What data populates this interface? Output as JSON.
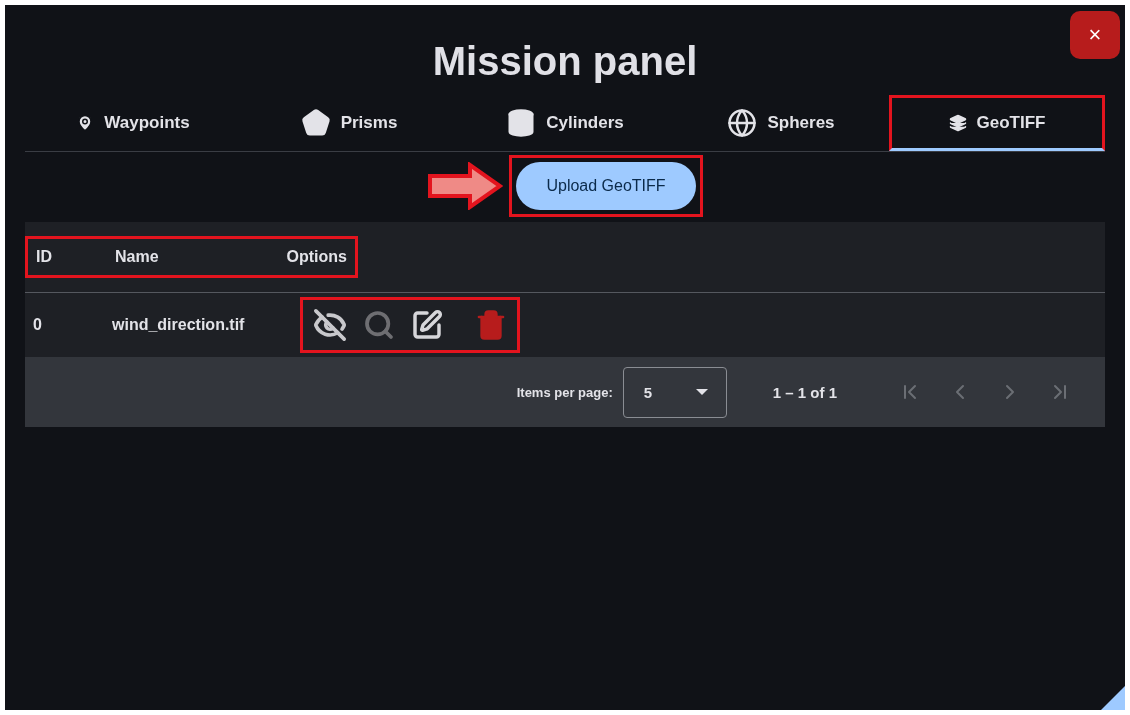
{
  "title": "Mission panel",
  "close_button": {
    "label": "×"
  },
  "tabs": [
    {
      "label": "Waypoints",
      "selected": false,
      "highlighted": false
    },
    {
      "label": "Prisms",
      "selected": false,
      "highlighted": false
    },
    {
      "label": "Cylinders",
      "selected": false,
      "highlighted": false
    },
    {
      "label": "Spheres",
      "selected": false,
      "highlighted": false
    },
    {
      "label": "GeoTIFF",
      "selected": true,
      "highlighted": true
    }
  ],
  "upload_button": {
    "label": "Upload GeoTIFF",
    "highlighted": true,
    "arrow": true
  },
  "table": {
    "columns": [
      "ID",
      "Name",
      "Options"
    ],
    "header_highlighted": true,
    "rows": [
      {
        "id": "0",
        "name": "wind_direction.tif",
        "visible": false,
        "actions_highlighted": true
      }
    ]
  },
  "paginator": {
    "label": "Items per page:",
    "page_size": "5",
    "range": "1 – 1 of 1"
  }
}
